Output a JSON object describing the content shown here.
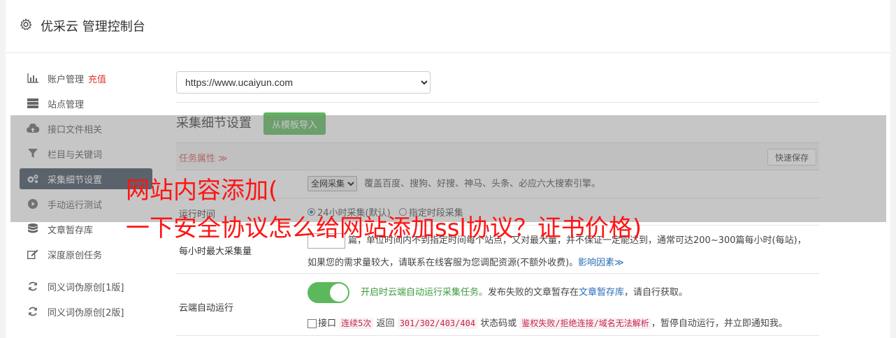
{
  "header": {
    "title": "优采云 管理控制台",
    "icon": "gear-icon"
  },
  "sidebar": {
    "items": [
      {
        "label": "账户管理",
        "extra": "充值",
        "icon": "bar-chart-icon"
      },
      {
        "label": "站点管理",
        "icon": "server-icon"
      },
      {
        "label": "接口文件相关",
        "icon": "cloud-upload-icon"
      },
      {
        "label": "栏目与关键词",
        "icon": "filter-icon"
      },
      {
        "label": "采集细节设置",
        "icon": "gears-icon",
        "active": true
      },
      {
        "label": "手动运行测试",
        "icon": "play-circle-icon"
      },
      {
        "label": "文章暂存库",
        "icon": "database-icon"
      },
      {
        "label": "深度原创任务",
        "icon": "edit-icon"
      },
      {
        "label": "同义词伪原创[1版]",
        "icon": "refresh-icon"
      },
      {
        "label": "同义词伪原创[2版]",
        "icon": "refresh-icon"
      }
    ]
  },
  "main": {
    "site_select": {
      "selected": "https://www.ucaiyun.com"
    },
    "section_title": "采集细节设置",
    "template_button": "从模板导入",
    "table": {
      "task_attr": "任务属性 ≫",
      "quick_save": "快速保存",
      "source_row": {
        "select": "全网采集",
        "desc": "覆盖百度、搜狗、好搜、神马、头条、必应六大搜索引擎。"
      },
      "run_time": {
        "label": "运行时间",
        "opt1": "24小时采集(默认)",
        "opt2": "指定时段采集"
      },
      "max_per_hour": {
        "label": "每小时最大采集量",
        "line1": "篇，单位时间内不到指定时间每个站点，又对最大量，并不保证一定能达到，通常可达200~300篇每小时(每站)，",
        "line2": "如果您的需求量较大，请联系在线客服为您调配资源(不额外收费)。",
        "link": "影响因素≫"
      },
      "cloud_run": {
        "label": "云端自动运行",
        "on_text": "开启时云端自动运行采集任务。",
        "text2": "发布失败的文章暂存在",
        "link": "文章暂存库",
        "text3": "，请自行获取。",
        "c1": "接口",
        "code1": "连续5次",
        "c2": "返回",
        "code2": "301/302/403/404",
        "c3": "状态码或",
        "code3": "鉴权失败/拒绝连接/域名无法解析",
        "c4": "，暂停自动运行，并立即通知我。"
      }
    }
  },
  "overlay": {
    "title_line1": "网站内容添加(",
    "title_line2": "一下安全协议怎么给网站添加ssl协议？证书价格)"
  },
  "colors": {
    "active_nav": "#3b4a5a",
    "green": "#5cb85c",
    "accent_red": "#d9534f",
    "overlay_red": "#ff1414"
  }
}
